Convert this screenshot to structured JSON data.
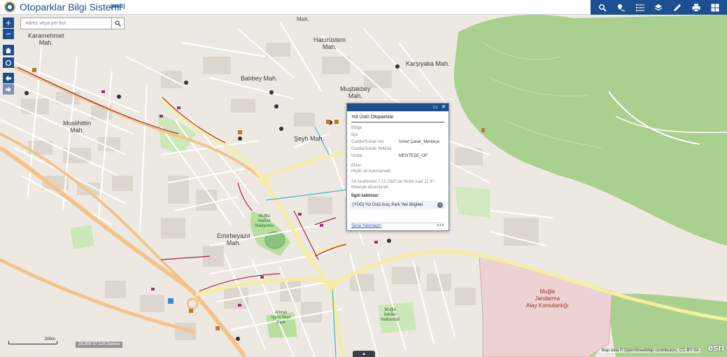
{
  "app": {
    "title": "Otoparklar Bilgi Sistemi",
    "subtitle": "[MBB]"
  },
  "toolbar": [
    {
      "name": "search-tool-icon"
    },
    {
      "name": "location-tool-icon"
    },
    {
      "name": "layer-list-icon"
    },
    {
      "name": "layers-icon"
    },
    {
      "name": "draw-icon"
    },
    {
      "name": "print-icon"
    },
    {
      "name": "app-grid-icon"
    }
  ],
  "search": {
    "placeholder": "Adres veya yer bul"
  },
  "map_labels": {
    "karamehmet": "Karamehmet\nMah.",
    "mah_top": "Mah.",
    "hacirustem": "Hacırüstem\nMah.",
    "karsiyaka": "Karşıyaka Mah.",
    "balibey": "Balıbey Mah.",
    "mustakbey": "Muştakbey\nMah.",
    "muslihittin": "Muslihittin\nMah.",
    "seyh": "Şeyh Mah.",
    "emirbeyazit": "Emirbeyazıt\nMah.",
    "stadium": "Muğla\nAtatürk\nStadyumu",
    "ahmet_park": "Ahmet\nİçten Yeşil\nPark",
    "nalbantlar": "Muğla\nİlahiler\nNalbantlar",
    "jandarma": "Muğla\nJandarma\nAlay Komutanlığı"
  },
  "popup": {
    "title": "Yol Üstü Otoparklar",
    "fields": [
      {
        "key": "Bölge",
        "value": ""
      },
      {
        "key": "İlçe",
        "value": ""
      },
      {
        "key": "Cadde/Sokak Adı",
        "value": "İsmet Çatak_Menteşe"
      },
      {
        "key": "Cadde/Sokak Yetkilisi",
        "value": ""
      },
      {
        "key": "Notlar",
        "value": "MENTEŞE_OP"
      }
    ],
    "attachments_label": "Ekler:",
    "attachments_text": "Hiçbir ek bulunamadı",
    "edit_info": "SA tarafından 7.12.2020 tar hinde saat 11:47 itibariyle düzenlendi",
    "related_title": "İlgili tablolar:",
    "related_item": "[YÜO] Yol Üstü Araç Park Yeri Bilgileri",
    "zoom_link": "Şuna Yakınlaştır",
    "more": "•••"
  },
  "scale": {
    "label": "200m"
  },
  "coordinates": "28,359 37,229 Derece",
  "attribution": "Map data © OpenStreetMap contributors, CC-BY-SA",
  "esri": "esri",
  "colors": {
    "accent": "#1c4f91",
    "forest": "#a6cf8f",
    "land": "#f2efe9",
    "military": "#efd3d3",
    "main_road": "#f6c98f",
    "secondary_road": "#f5efa5"
  }
}
